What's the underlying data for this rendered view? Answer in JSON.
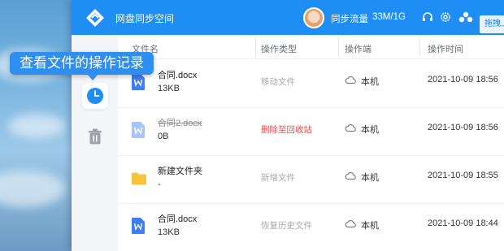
{
  "app": {
    "title": "网盘同步空间"
  },
  "header": {
    "sync_label": "同步流量",
    "sync_value": "33M/1G",
    "drag_button": "拖拽上"
  },
  "tooltip": {
    "text": "查看文件的操作记录"
  },
  "sidebar": {
    "items": [
      {
        "icon": "clock-icon",
        "active": true
      },
      {
        "icon": "trash-icon",
        "active": false
      }
    ]
  },
  "table": {
    "columns": [
      "文件名",
      "操作类型",
      "操作端",
      "操作时间"
    ],
    "rows": [
      {
        "name": "合同.docx",
        "size": "13KB",
        "type": "移动文件",
        "device": "本机",
        "time": "2021-10-09 18:56"
      },
      {
        "name": "合同2.docx",
        "size": "0B",
        "type": "删除至回收站",
        "device": "本机",
        "time": "2021-10-09 18:56"
      },
      {
        "name": "新建文件夹",
        "size": "-",
        "type": "新增文件",
        "device": "本机",
        "time": "2021-10-09 18:55"
      },
      {
        "name": "合同.docx",
        "size": "13KB",
        "type": "恢复历史文件",
        "device": "本机",
        "time": "2021-10-09 18:44"
      }
    ]
  },
  "colors": {
    "accent": "#1e8ef5",
    "danger": "#f04848",
    "folder": "#f7c53b",
    "doc": "#3d7ff0"
  }
}
